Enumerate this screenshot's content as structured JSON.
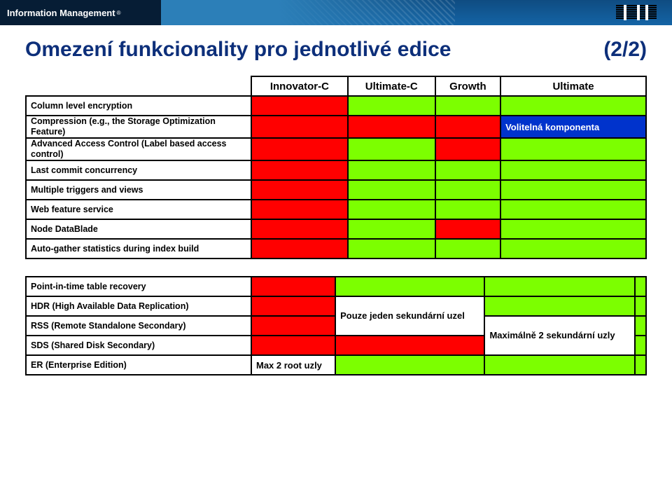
{
  "header": {
    "brand": "Information Management",
    "tm": "®",
    "logo_name": "ibm-logo"
  },
  "title": "Omezení funkcionality pro jednotlivé edice",
  "title_page": "(2/2)",
  "columns": [
    "Innovator-C",
    "Ultimate-C",
    "Growth",
    "Ultimate"
  ],
  "rows": [
    {
      "label": "Column level encryption",
      "cells": [
        "red",
        "grn",
        "grn",
        "grn"
      ]
    },
    {
      "label": "Compression (e.g., the Storage Optimization Feature)",
      "cells": [
        "red",
        "red",
        "red",
        "blu"
      ],
      "note": "Volitelná komponenta"
    },
    {
      "label": "Advanced Access Control (Label based access control)",
      "cells": [
        "red",
        "grn",
        "red",
        "grn"
      ]
    },
    {
      "label": "Last commit concurrency",
      "cells": [
        "red",
        "grn",
        "grn",
        "grn"
      ]
    },
    {
      "label": "Multiple triggers and views",
      "cells": [
        "red",
        "grn",
        "grn",
        "grn"
      ]
    },
    {
      "label": "Web feature service",
      "cells": [
        "red",
        "grn",
        "grn",
        "grn"
      ]
    },
    {
      "label": "Node DataBlade",
      "cells": [
        "red",
        "grn",
        "red",
        "grn"
      ]
    },
    {
      "label": "Auto-gather statistics during index build",
      "cells": [
        "red",
        "grn",
        "grn",
        "grn"
      ]
    }
  ],
  "rows2": [
    {
      "label": "Point-in-time table recovery",
      "cells": [
        {
          "cls": "red"
        },
        {
          "cls": "grn"
        },
        {
          "cls": "grn"
        },
        {
          "cls": "grn"
        }
      ]
    },
    {
      "label": "HDR (High Available Data Replication)",
      "cells": [
        {
          "cls": "red"
        },
        {
          "cls": "wht",
          "txt": "Pouze jeden",
          "rs": 2
        },
        {
          "cls": "grn"
        },
        {
          "cls": "grn"
        }
      ]
    },
    {
      "label": "RSS (Remote Standalone Secondary)",
      "cells": [
        {
          "cls": "red"
        },
        {
          "skip": true
        },
        {
          "cls": "wht",
          "txt": "Maximálně 2",
          "rs": 2
        },
        {
          "cls": "grn"
        }
      ],
      "note2a": "sekundární uzel",
      "note2b": "sekundární uzly"
    },
    {
      "label": "SDS (Shared Disk Secondary)",
      "cells": [
        {
          "cls": "red"
        },
        {
          "cls": "red"
        },
        {
          "skip": true
        },
        {
          "cls": "grn"
        }
      ]
    },
    {
      "label": "ER (Enterprise Edition)",
      "cells": [
        {
          "cls": "wht",
          "txt": "Max 2 root uzly"
        },
        {
          "cls": "grn"
        },
        {
          "cls": "grn"
        },
        {
          "cls": "grn"
        }
      ]
    }
  ],
  "cell_text": {
    "vk": "Volitelná komponenta",
    "pj": "Pouze jeden sekundární uzel",
    "m2": "Maximálně 2 sekundární uzly",
    "mx": "Max 2 root uzly"
  }
}
